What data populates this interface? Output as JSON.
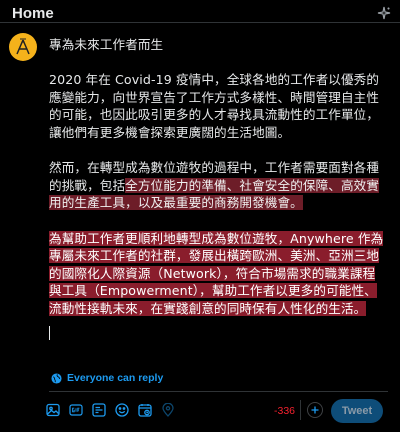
{
  "header": {
    "title": "Home",
    "sparkle_icon": "sparkle-icon"
  },
  "composer": {
    "avatar_icon": "account-avatar",
    "title_line": "專為未來工作者而生",
    "paragraph1": "2020 年在 Covid-19 疫情中，全球各地的工作者以優秀的應變能力，向世界宣告了工作方式多樣性、時間管理自主性的可能，也因此吸引更多的人才尋找具流動性的工作單位，讓他們有更多機會探索更廣闊的生活地圖。",
    "paragraph2_plain": "然而，在轉型成為數位遊牧的過程中，工作者需要面對各種的挑戰，包括",
    "paragraph2_highlight": "全方位能力的準備、社會安全的保障、高效實用的生產工具，以及最重要的商務開發機會。",
    "paragraph3": "為幫助工作者更順利地轉型成為數位遊牧，Anywhere 作為專屬未來工作者的社群，發展出橫跨歐洲、美洲、亞洲三地的國際化人際資源（Network），符合市場需求的職業課程與工具（Empowerment），幫助工作者以更多的可能性、流動性接軌未來，在實踐創意的同時保有人性化的生活。"
  },
  "reply_setting": {
    "label": "Everyone can reply",
    "icon": "globe-icon"
  },
  "toolbar": {
    "tools": [
      {
        "name": "media-icon",
        "glyph": "▣"
      },
      {
        "name": "gif-icon",
        "glyph": "GIF"
      },
      {
        "name": "poll-icon",
        "glyph": "☰"
      },
      {
        "name": "emoji-icon",
        "glyph": "☺"
      },
      {
        "name": "schedule-icon",
        "glyph": "◷"
      },
      {
        "name": "location-icon",
        "glyph": "⌖"
      }
    ],
    "char_count": "-336",
    "add_thread_icon": "plus-icon",
    "tweet_label": "Tweet"
  },
  "colors": {
    "accent": "#1d9bf0",
    "highlight": "#6d1d28",
    "count_over": "#f4212e",
    "tweet_disabled": "#0e4d79"
  }
}
